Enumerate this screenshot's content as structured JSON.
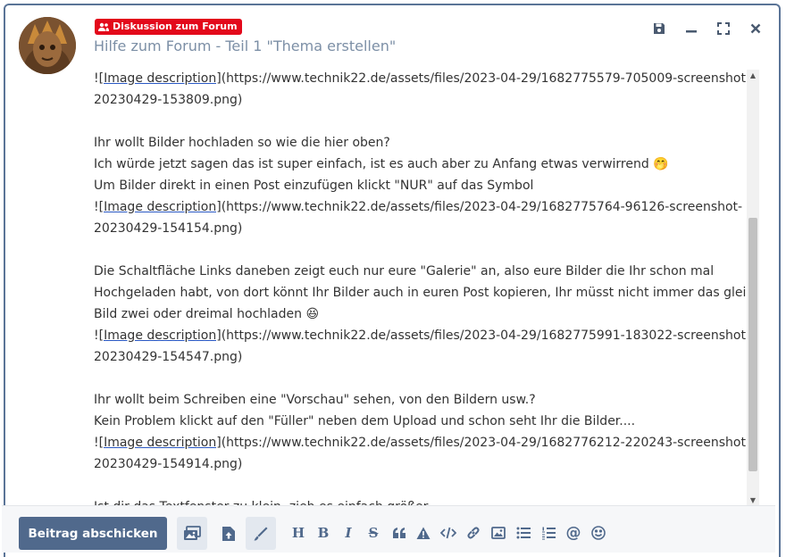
{
  "badge": {
    "label": "Diskussion zum Forum",
    "icon": "users-icon",
    "color": "#e3091b"
  },
  "title": "Hilfe zum Forum - Teil 1 \"Thema erstellen\"",
  "window_controls": [
    "save-icon",
    "minimize-icon",
    "fullscreen-icon",
    "close-icon"
  ],
  "editor": {
    "lines": [
      {
        "pre": "!",
        "link": "[Image description]",
        "post": "(https://www.technik22.de/assets/files/2023-04-29/1682775579-705009-screenshot-"
      },
      {
        "text": "20230429-153809.png)"
      },
      {
        "text": ""
      },
      {
        "text": "Ihr wollt Bilder hochladen so wie die hier oben?"
      },
      {
        "text": "Ich würde jetzt sagen das ist super einfach, ist es auch aber zu Anfang etwas verwirrend 🤭"
      },
      {
        "text": "Um Bilder direkt in einen Post einzufügen klickt \"NUR\" auf das Symbol"
      },
      {
        "pre": "!",
        "link": "[Image description]",
        "post": "(https://www.technik22.de/assets/files/2023-04-29/1682775764-96126-screenshot-"
      },
      {
        "text": "20230429-154154.png)"
      },
      {
        "text": ""
      },
      {
        "text": "Die Schaltfläche Links daneben zeigt euch nur eure \"Galerie\" an, also eure Bilder die Ihr schon mal"
      },
      {
        "text": "Hochgeladen habt, von dort könnt Ihr Bilder auch in euren Post kopieren, Ihr müsst nicht immer das gleiche"
      },
      {
        "text": "Bild zwei oder dreimal hochladen 😆"
      },
      {
        "pre": "!",
        "link": "[Image description]",
        "post": "(https://www.technik22.de/assets/files/2023-04-29/1682775991-183022-screenshot-"
      },
      {
        "text": "20230429-154547.png)"
      },
      {
        "text": ""
      },
      {
        "text": "Ihr wollt beim Schreiben eine \"Vorschau\" sehen, von den Bildern usw.?"
      },
      {
        "text": "Kein Problem klickt auf den \"Füller\" neben dem Upload und schon seht Ihr die Bilder...."
      },
      {
        "pre": "!",
        "link": "[Image description]",
        "post": "(https://www.technik22.de/assets/files/2023-04-29/1682776212-220243-screenshot-"
      },
      {
        "text": "20230429-154914.png)"
      },
      {
        "text": ""
      },
      {
        "text": "Ist dir das Textfenster zu klein, zieh es einfach größer"
      }
    ]
  },
  "toolbar": {
    "submit_label": "Beitrag abschicken",
    "tools": [
      {
        "name": "gallery-icon",
        "active": true
      },
      {
        "name": "upload-icon",
        "active": false
      },
      {
        "name": "preview-pen-icon",
        "active": true
      },
      {
        "name": "heading-icon",
        "glyph": "H"
      },
      {
        "name": "bold-icon",
        "glyph": "B"
      },
      {
        "name": "italic-icon",
        "glyph": "I"
      },
      {
        "name": "strikethrough-icon",
        "glyph": "S"
      },
      {
        "name": "quote-icon",
        "glyph": "❝"
      },
      {
        "name": "warning-icon",
        "glyph": "⚠"
      },
      {
        "name": "code-icon",
        "glyph": "</>"
      },
      {
        "name": "link-icon",
        "glyph": "🔗"
      },
      {
        "name": "image-icon",
        "glyph": "▣"
      },
      {
        "name": "bulleted-list-icon",
        "glyph": "☰"
      },
      {
        "name": "numbered-list-icon",
        "glyph": "⒈"
      },
      {
        "name": "mention-icon",
        "glyph": "@"
      },
      {
        "name": "emoji-icon",
        "glyph": "☺"
      }
    ]
  }
}
